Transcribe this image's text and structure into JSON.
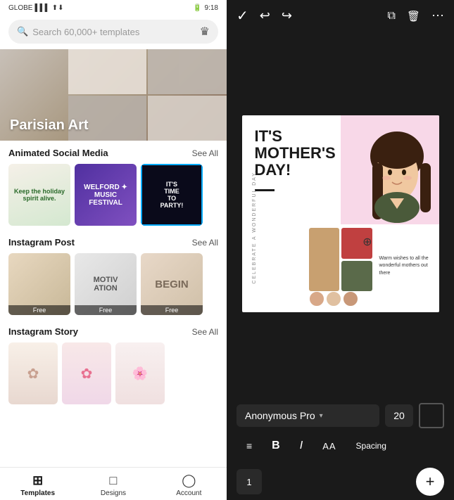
{
  "status_bar": {
    "carrier": "GLOBE",
    "time": "9:18",
    "battery": "1"
  },
  "search": {
    "placeholder": "Search 60,000+ templates"
  },
  "hero": {
    "title": "Parisian Art"
  },
  "sections": {
    "animated": {
      "title": "Animated Social Media",
      "see_all": "See All",
      "cards": [
        {
          "text": "Keep the holiday spirit alive."
        },
        {
          "name": "WELFORD ✦\nMUSIC FESTIVAL"
        },
        {
          "text": "IT'S\nTIME\nTO\nPARTY!"
        }
      ]
    },
    "instagram_post": {
      "title": "Instagram Post",
      "see_all": "See All",
      "cards": [
        {
          "badge": "Free"
        },
        {
          "text": "MOTIV\nATION",
          "badge": "Free"
        },
        {
          "text": "BEGIN",
          "badge": "Free"
        }
      ]
    },
    "instagram_story": {
      "title": "Instagram Story",
      "see_all": "See All"
    }
  },
  "bottom_nav": [
    {
      "label": "Templates",
      "icon": "⊞",
      "active": true
    },
    {
      "label": "Designs",
      "icon": "□"
    },
    {
      "label": "Account",
      "icon": "◯"
    }
  ],
  "right_panel": {
    "toolbar": {
      "check": "✓",
      "undo": "↩",
      "redo": "↪",
      "copy": "⧉",
      "delete": "🗑",
      "more": "⋯"
    },
    "canvas": {
      "title_line1": "IT'S",
      "title_line2": "MOTHER'S",
      "title_line3": "DAY!",
      "vertical_text": "CELEBRATE A WONDERFUL DAY.",
      "wish_text": "Warm wishes to all the wonderful mothers out there"
    },
    "font_controls": {
      "font_name": "Anonymous Pro",
      "font_size": "20",
      "color_label": "Color"
    },
    "format_controls": {
      "align": "≡",
      "bold": "B",
      "italic": "I",
      "aa": "AA",
      "spacing": "Spacing"
    },
    "bottom_bar": {
      "layer_num": "1",
      "add_label": "+"
    }
  }
}
